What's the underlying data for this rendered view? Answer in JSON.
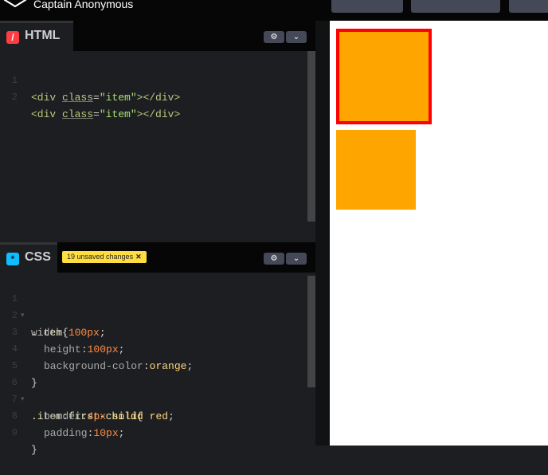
{
  "header": {
    "author": "Captain Anonymous"
  },
  "html_panel": {
    "title": "HTML",
    "lines": [
      {
        "num": "1",
        "open": "<div ",
        "attr": "class",
        "eq": "=",
        "val": "\"item\"",
        "close": "></div>"
      },
      {
        "num": "2",
        "open": "<div ",
        "attr": "class",
        "eq": "=",
        "val": "\"item\"",
        "close": "></div>"
      }
    ]
  },
  "css_panel": {
    "title": "CSS",
    "badge": "19 unsaved changes",
    "badge_close": "✕",
    "lines": [
      {
        "num": "1",
        "fold": "▾"
      },
      {
        "num": "2"
      },
      {
        "num": "3"
      },
      {
        "num": "4"
      },
      {
        "num": "5"
      },
      {
        "num": "6",
        "fold": "▾"
      },
      {
        "num": "7"
      },
      {
        "num": "8"
      },
      {
        "num": "9"
      }
    ],
    "tokens": {
      "sel1": ".item",
      "brace_open": "{",
      "brace_close": "}",
      "width": "width",
      "w_num": "100",
      "w_unit": "px",
      "height": "height",
      "h_num": "100",
      "h_unit": "px",
      "bg": "background-color",
      "bg_val": "orange",
      "sel2": ".item",
      "pseudo": ":first-child",
      "border": "border",
      "b_num": "4",
      "b_unit": "px",
      "b_rest": " solid red",
      "padding": "padding",
      "p_num": "10",
      "p_unit": "px",
      "colon": ":",
      "semi": ";"
    }
  },
  "icons": {
    "gear": "⚙",
    "chevron": "⌄"
  },
  "colors": {
    "orange": "#ffa500",
    "red": "#ff0000",
    "badge": "#ffdd40",
    "html_icon": "#ff3c41",
    "css_icon": "#0ebeff"
  }
}
